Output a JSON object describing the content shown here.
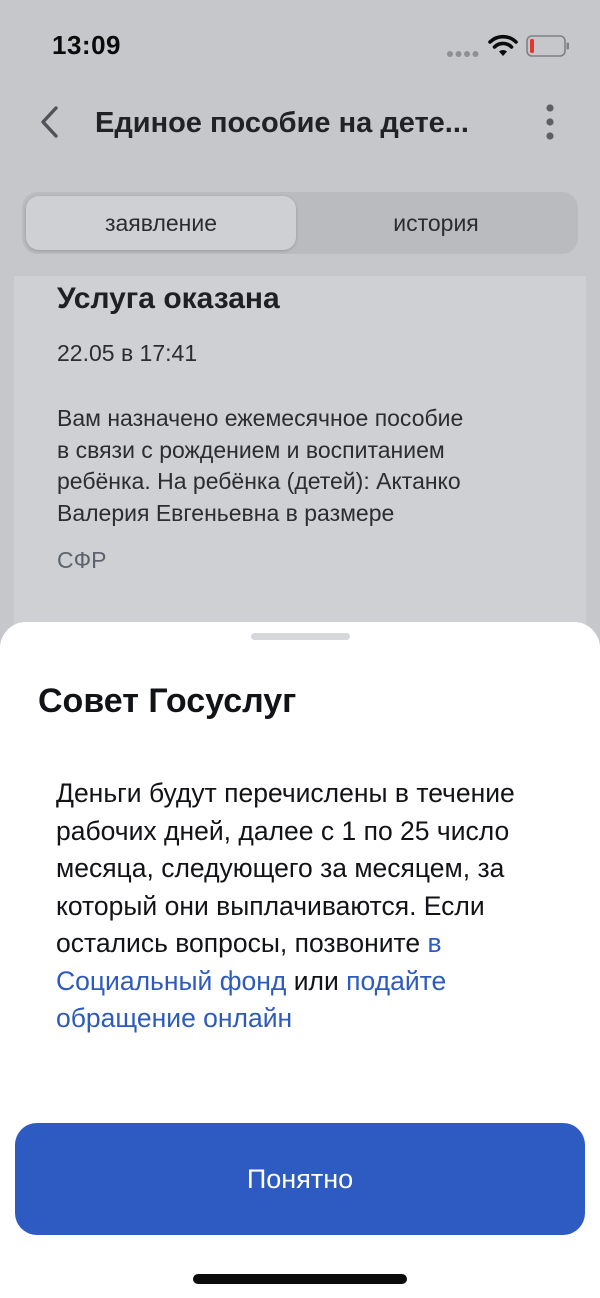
{
  "status_bar": {
    "time": "13:09"
  },
  "header": {
    "title": "Единое пособие на дете..."
  },
  "tabs": [
    {
      "label": "заявление",
      "active": true
    },
    {
      "label": "история",
      "active": false
    }
  ],
  "card": {
    "title": "Услуга оказана",
    "date": "22.05 в 17:41",
    "lines": [
      "Вам назначено ежемесячное пособие",
      "в связи с рождением и воспитанием",
      "ребёнка. На ребёнка (детей): Актанко",
      "Валерия Евгеньевна в размере"
    ],
    "source": "СФР"
  },
  "sheet": {
    "title": "Совет Госуслуг",
    "line1": "Деньги будут перечислены в течение",
    "line2": "рабочих дней, далее с 1 по 25 число",
    "line3": "месяца, следующего за месяцем, за",
    "line4": "который они выплачиваются. Если",
    "line5_text": "остались вопросы, позвоните ",
    "line5_link": "в",
    "line6_link": "Социальный фонд",
    "line6_text": " или ",
    "line6_link2": "подайте",
    "line7_link": "обращение онлайн",
    "button_label": "Понятно"
  },
  "colors": {
    "primary": "#2d5bc1",
    "link": "#2d5bbd",
    "overlay_background": "#c6c7ca"
  }
}
